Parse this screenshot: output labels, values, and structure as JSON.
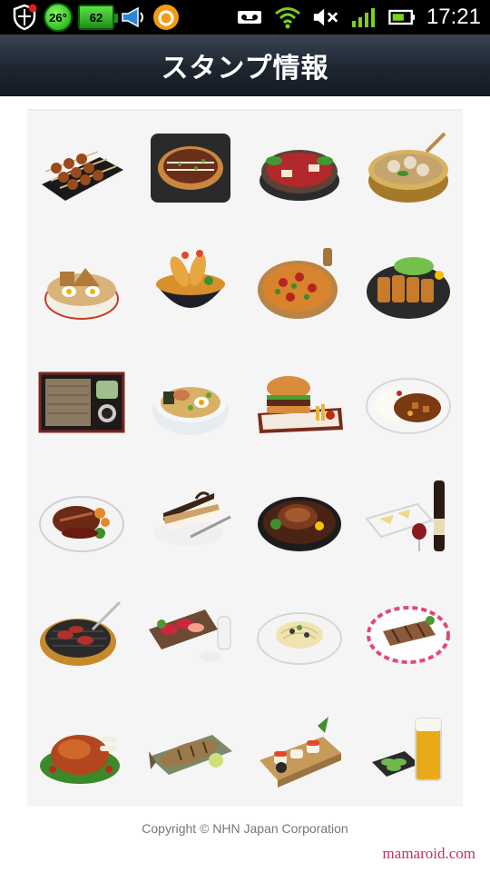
{
  "status_bar": {
    "temperature": "26°",
    "battery_percent": "62",
    "time": "17:21"
  },
  "header": {
    "title": "スタンプ情報"
  },
  "stickers": [
    {
      "name": "yakitori"
    },
    {
      "name": "okonomiyaki"
    },
    {
      "name": "sukiyaki"
    },
    {
      "name": "nabe"
    },
    {
      "name": "oden"
    },
    {
      "name": "tendon"
    },
    {
      "name": "pizza"
    },
    {
      "name": "tonkatsu"
    },
    {
      "name": "zaru-soba"
    },
    {
      "name": "ramen"
    },
    {
      "name": "hamburger"
    },
    {
      "name": "curry-rice"
    },
    {
      "name": "steak"
    },
    {
      "name": "cake"
    },
    {
      "name": "hamburg-steak"
    },
    {
      "name": "wine-and-cheese"
    },
    {
      "name": "yakiniku"
    },
    {
      "name": "sashimi"
    },
    {
      "name": "pasta"
    },
    {
      "name": "grilled-fish-fillet"
    },
    {
      "name": "roast-chicken"
    },
    {
      "name": "grilled-fish"
    },
    {
      "name": "sushi"
    },
    {
      "name": "beer-and-edamame"
    }
  ],
  "footer": {
    "copyright": "Copyright © NHN Japan Corporation",
    "watermark": "mamaroid.com"
  },
  "colors": {
    "title_bar": "#1d2530",
    "grid_background": "#f5f5f5",
    "watermark": "#c0306a"
  }
}
